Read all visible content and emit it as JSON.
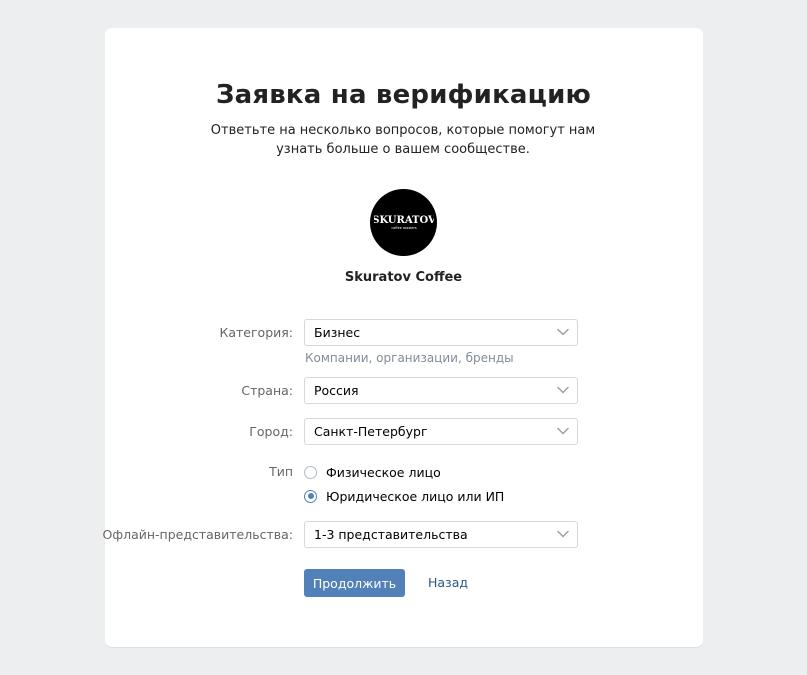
{
  "page": {
    "title": "Заявка на верификацию",
    "subtitle": "Ответьте на несколько вопросов, которые помогут нам узнать больше о вашем сообществе."
  },
  "community": {
    "name": "Skuratov Coffee",
    "logo_text": "SKURATOV",
    "logo_subtext": "coffee roasters"
  },
  "form": {
    "category": {
      "label": "Категория:",
      "value": "Бизнес",
      "hint": "Компании, организации, бренды"
    },
    "country": {
      "label": "Страна:",
      "value": "Россия"
    },
    "city": {
      "label": "Город:",
      "value": "Санкт-Петербург"
    },
    "type": {
      "label": "Тип",
      "options": [
        {
          "label": "Физическое лицо",
          "checked": false
        },
        {
          "label": "Юридическое лицо или ИП",
          "checked": true
        }
      ]
    },
    "offline": {
      "label": "Офлайн-представительства:",
      "value": "1-3 представительства"
    }
  },
  "actions": {
    "continue_label": "Продолжить",
    "back_label": "Назад"
  },
  "colors": {
    "accent": "#5181b8",
    "link": "#2a5885",
    "background": "#edeef0"
  }
}
